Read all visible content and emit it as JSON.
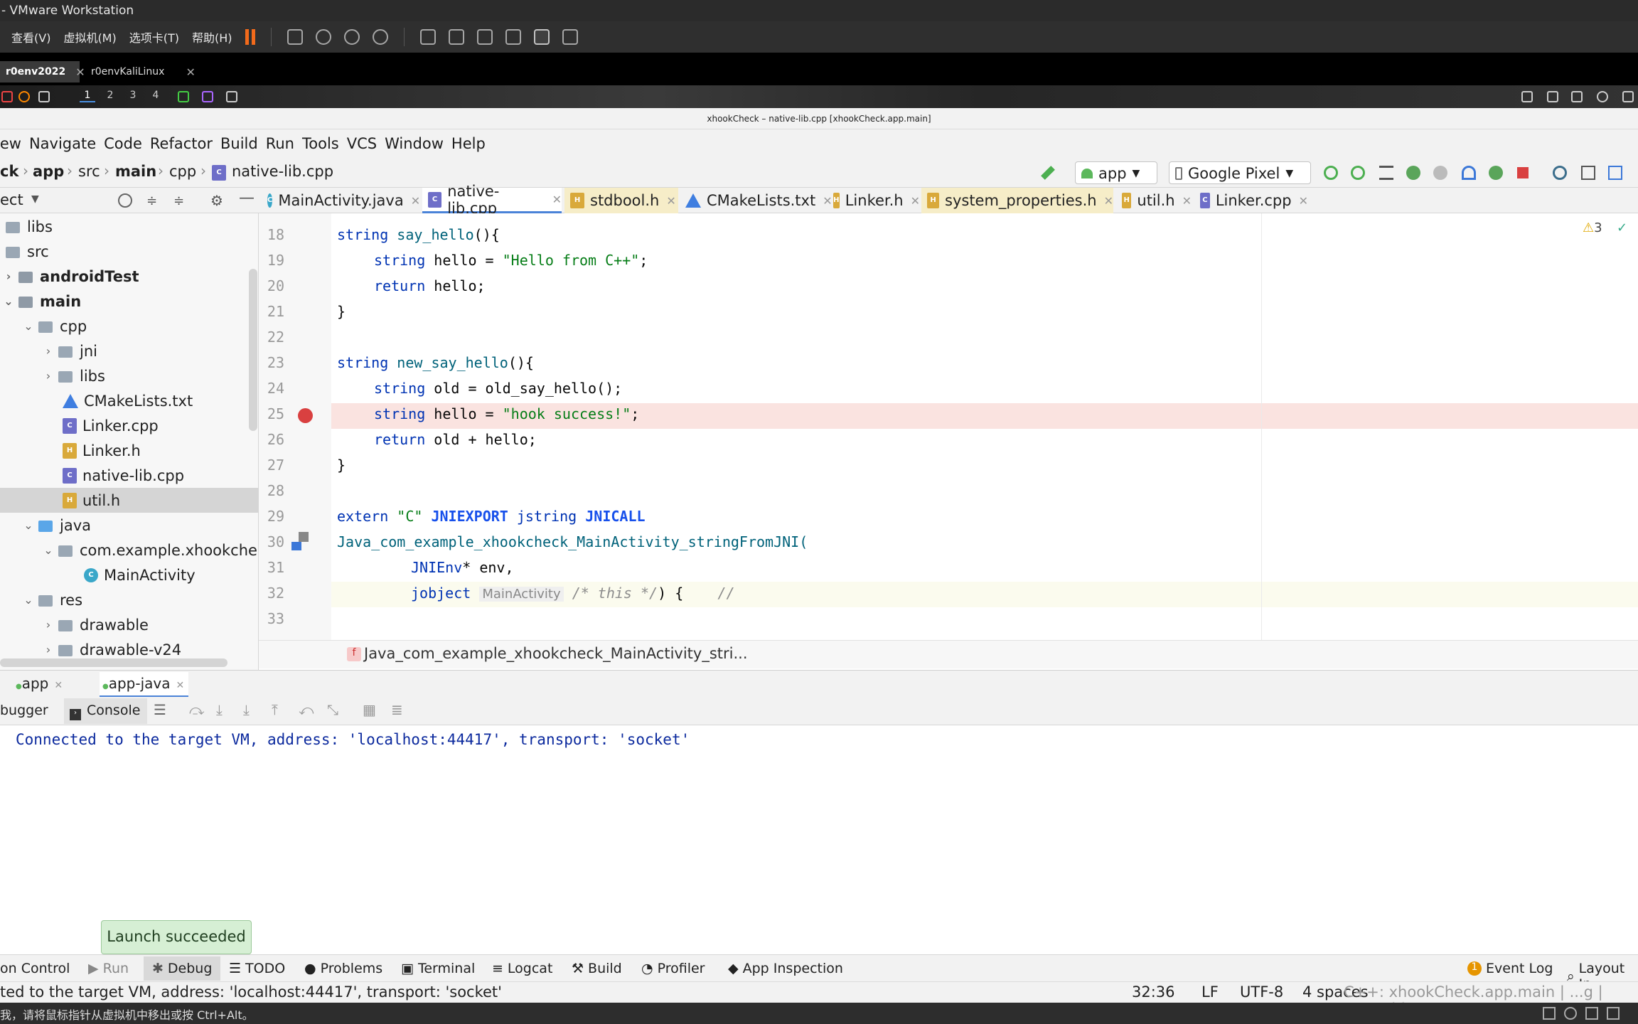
{
  "vm": {
    "title": "- VMware Workstation",
    "menu": [
      "查看(V)",
      "虚拟机(M)",
      "选项卡(T)",
      "帮助(H)"
    ],
    "tabs": [
      {
        "label": "r0env2022"
      },
      {
        "label": "r0envKaliLinux"
      }
    ],
    "status_hint": "我，请将鼠标指针从虚拟机中移出或按 Ctrl+Alt。"
  },
  "panel": {
    "workspaces": [
      "1",
      "2",
      "3",
      "4"
    ]
  },
  "window_title": "xhookCheck – native-lib.cpp [xhookCheck.app.main]",
  "menu": [
    "iew",
    "Navigate",
    "Code",
    "Refactor",
    "Build",
    "Run",
    "Tools",
    "VCS",
    "Window",
    "Help"
  ],
  "breadcrumbs": [
    "ck",
    "app",
    "src",
    "main",
    "cpp",
    "native-lib.cpp"
  ],
  "run_config": "app",
  "device": "Google Pixel",
  "project_header": "ect",
  "tree": [
    {
      "label": "libs"
    },
    {
      "label": "src"
    },
    {
      "label": "androidTest"
    },
    {
      "label": "main"
    },
    {
      "label": "cpp"
    },
    {
      "label": "jni"
    },
    {
      "label": "libs"
    },
    {
      "label": "CMakeLists.txt"
    },
    {
      "label": "Linker.cpp"
    },
    {
      "label": "Linker.h"
    },
    {
      "label": "native-lib.cpp"
    },
    {
      "label": "util.h"
    },
    {
      "label": "java"
    },
    {
      "label": "com.example.xhookcheck"
    },
    {
      "label": "MainActivity"
    },
    {
      "label": "res"
    },
    {
      "label": "drawable"
    },
    {
      "label": "drawable-v24"
    }
  ],
  "editor_tabs": [
    "MainActivity.java",
    "native-lib.cpp",
    "stdbool.h",
    "CMakeLists.txt",
    "Linker.h",
    "system_properties.h",
    "util.h",
    "Linker.cpp"
  ],
  "warnings": "3",
  "line_numbers": [
    "18",
    "19",
    "20",
    "21",
    "22",
    "23",
    "24",
    "25",
    "26",
    "27",
    "28",
    "29",
    "30",
    "31",
    "32",
    "33"
  ],
  "code": {
    "l18a": "string",
    "l18b": "say_hello",
    "l18c": "(){",
    "l19a": "string",
    "l19b": " hello = ",
    "l19c": "\"Hello from C++\"",
    "l19d": ";",
    "l20a": "return",
    "l20b": " hello;",
    "l21": "}",
    "l23a": "string",
    "l23b": "new_say_hello",
    "l23c": "(){",
    "l24a": "string",
    "l24b": " old = old_say_hello();",
    "l25a": "string",
    "l25b": " hello = ",
    "l25c": "\"hook success!\"",
    "l25d": ";",
    "l26a": "return",
    "l26b": " old + hello;",
    "l27": "}",
    "l29a": "extern",
    "l29b": "\"C\"",
    "l29c": "JNIEXPORT",
    "l29d": "jstring",
    "l29e": "JNICALL",
    "l30": "Java_com_example_xhookcheck_MainActivity_stringFromJNI(",
    "l31a": "JNIEnv",
    "l31b": "* env,",
    "l32a": "jobject",
    "l32hint": "MainActivity",
    "l32c": "/* this */",
    "l32d": ") {",
    "l32e": "//"
  },
  "function_crumb": "Java_com_example_xhookcheck_MainActivity_stri...",
  "debug": {
    "tabs": [
      "app",
      "app-java"
    ],
    "subtabs": [
      "bugger",
      "Console"
    ],
    "console_line": "Connected to the target VM, address: 'localhost:44417', transport: 'socket'"
  },
  "toast": "Launch succeeded",
  "toolwindows": [
    "on Control",
    "Run",
    "Debug",
    "TODO",
    "Problems",
    "Terminal",
    "Logcat",
    "Build",
    "Profiler",
    "App Inspection"
  ],
  "event_log": "Event Log",
  "event_count": "1",
  "layout_inspector": "Layout In",
  "status": {
    "message": "ted to the target VM, address: 'localhost:44417', transport: 'socket'",
    "position": "32:36",
    "line_sep": "LF",
    "encoding": "UTF-8",
    "indent": "4 spaces",
    "context": "C++: xhookCheck.app.main | ...g | armeabi-"
  }
}
